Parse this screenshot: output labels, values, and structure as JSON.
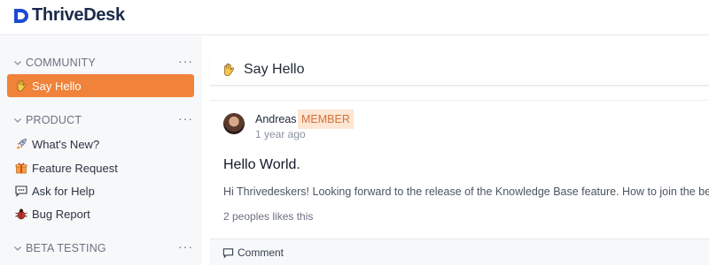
{
  "app": {
    "brand": "ThriveDesk",
    "brand_color": "#1b2a4a",
    "accent": "#f0823a"
  },
  "sidebar": {
    "sections": [
      {
        "title": "COMMUNITY",
        "more": "···"
      },
      {
        "title": "PRODUCT",
        "more": "···"
      },
      {
        "title": "BETA TESTING",
        "more": "···"
      }
    ],
    "items": [
      {
        "label": "Say Hello",
        "icon": "waving-hand-icon",
        "active": true
      },
      {
        "label": "What's New?",
        "icon": "rocket-icon",
        "active": false
      },
      {
        "label": "Feature Request",
        "icon": "gift-icon",
        "active": false
      },
      {
        "label": "Ask for Help",
        "icon": "speech-bubble-icon",
        "active": false
      },
      {
        "label": "Bug Report",
        "icon": "bug-icon",
        "active": false
      }
    ]
  },
  "channel": {
    "title": "Say Hello",
    "icon": "waving-hand-icon"
  },
  "post": {
    "author": "Andreas",
    "role_badge": "MEMBER",
    "time": "1 year ago",
    "title": "Hello World.",
    "body": "Hi Thrivedeskers! Looking forward to the release of the Knowledge Base feature. How to join the beta?",
    "likes": "2 peoples likes this",
    "comment_label": "Comment"
  }
}
